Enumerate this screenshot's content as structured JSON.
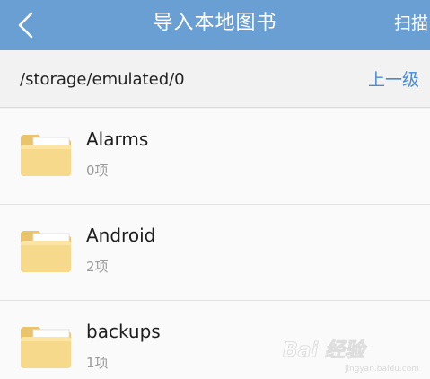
{
  "header": {
    "back_icon": "chevron-left-icon",
    "title": "导入本地图书",
    "scan_label": "扫描",
    "background_color": "#6a9fd4"
  },
  "path_bar": {
    "current_path": "/storage/emulated/0",
    "up_label": "上一级",
    "up_color": "#4a8ad0"
  },
  "folders": [
    {
      "name": "Alarms",
      "count": "0项",
      "icon": "folder-icon"
    },
    {
      "name": "Android",
      "count": "2项",
      "icon": "folder-icon"
    },
    {
      "name": "backups",
      "count": "1项",
      "icon": "folder-icon"
    }
  ],
  "watermark": {
    "text": "Bai 经验",
    "sub": "jingyan.baidu.com"
  }
}
